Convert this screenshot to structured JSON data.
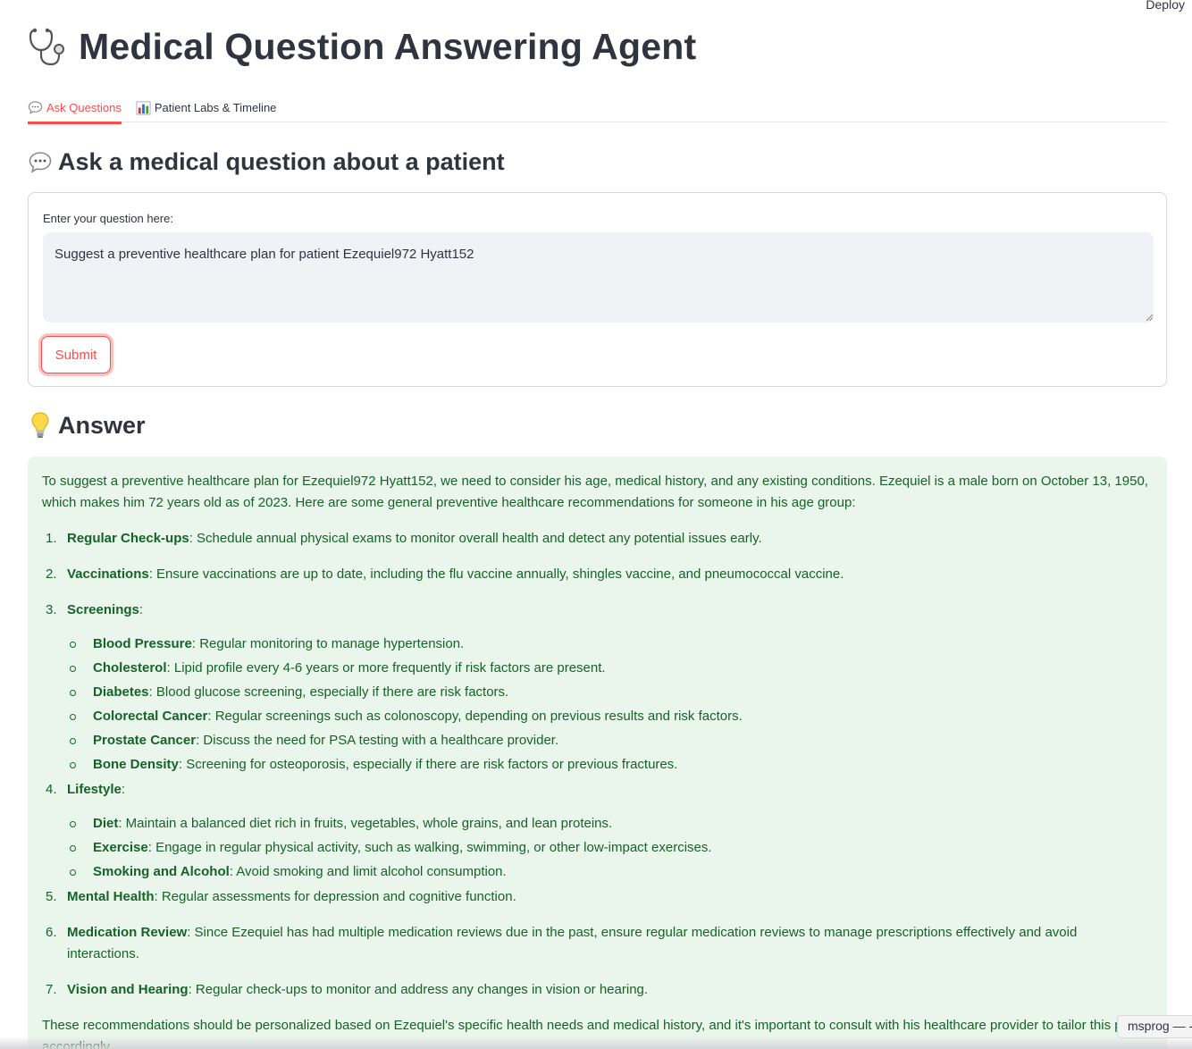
{
  "header": {
    "deploy_label": "Deploy"
  },
  "title": {
    "text": "Medical Question Answering Agent",
    "icon": "stethoscope-icon"
  },
  "tabs": [
    {
      "label": "Ask Questions",
      "icon": "speech-bubble-icon",
      "active": true
    },
    {
      "label": "Patient Labs & Timeline",
      "icon": "bar-chart-icon",
      "active": false
    }
  ],
  "ask_section": {
    "heading": "Ask a medical question about a patient",
    "icon": "speech-bubble-icon"
  },
  "form": {
    "label": "Enter your question here:",
    "question_value": "Suggest a preventive healthcare plan for patient Ezequiel972 Hyatt152",
    "submit_label": "Submit"
  },
  "answer_section": {
    "heading": "Answer",
    "icon": "light-bulb-icon"
  },
  "answer": {
    "intro": "To suggest a preventive healthcare plan for Ezequiel972 Hyatt152, we need to consider his age, medical history, and any existing conditions. Ezequiel is a male born on October 13, 1950, which makes him 72 years old as of 2023. Here are some general preventive healthcare recommendations for someone in his age group:",
    "items": [
      {
        "num": "1.",
        "title": "Regular Check-ups",
        "text": ": Schedule annual physical exams to monitor overall health and detect any potential issues early."
      },
      {
        "num": "2.",
        "title": "Vaccinations",
        "text": ": Ensure vaccinations are up to date, including the flu vaccine annually, shingles vaccine, and pneumococcal vaccine."
      },
      {
        "num": "3.",
        "title": "Screenings",
        "text": ":",
        "sub": [
          {
            "title": "Blood Pressure",
            "text": ": Regular monitoring to manage hypertension."
          },
          {
            "title": "Cholesterol",
            "text": ": Lipid profile every 4-6 years or more frequently if risk factors are present."
          },
          {
            "title": "Diabetes",
            "text": ": Blood glucose screening, especially if there are risk factors."
          },
          {
            "title": "Colorectal Cancer",
            "text": ": Regular screenings such as colonoscopy, depending on previous results and risk factors."
          },
          {
            "title": "Prostate Cancer",
            "text": ": Discuss the need for PSA testing with a healthcare provider."
          },
          {
            "title": "Bone Density",
            "text": ": Screening for osteoporosis, especially if there are risk factors or previous fractures."
          }
        ]
      },
      {
        "num": "4.",
        "title": "Lifestyle",
        "text": ":",
        "sub": [
          {
            "title": "Diet",
            "text": ": Maintain a balanced diet rich in fruits, vegetables, whole grains, and lean proteins."
          },
          {
            "title": "Exercise",
            "text": ": Engage in regular physical activity, such as walking, swimming, or other low-impact exercises."
          },
          {
            "title": "Smoking and Alcohol",
            "text": ": Avoid smoking and limit alcohol consumption."
          }
        ]
      },
      {
        "num": "5.",
        "title": "Mental Health",
        "text": ": Regular assessments for depression and cognitive function."
      },
      {
        "num": "6.",
        "title": "Medication Review",
        "text": ": Since Ezequiel has had multiple medication reviews due in the past, ensure regular medication reviews to manage prescriptions effectively and avoid interactions."
      },
      {
        "num": "7.",
        "title": "Vision and Hearing",
        "text": ": Regular check-ups to monitor and address any changes in vision or hearing."
      }
    ],
    "outro": "These recommendations should be personalized based on Ezequiel's specific health needs and medical history, and it's important to consult with his healthcare provider to tailor this plan accordingly."
  },
  "taskbar": {
    "label": "msprog — -"
  },
  "colors": {
    "accent": "#ff4b4b",
    "answer_bg": "#eaf6ec",
    "answer_text": "#176229",
    "text": "#31333f"
  }
}
